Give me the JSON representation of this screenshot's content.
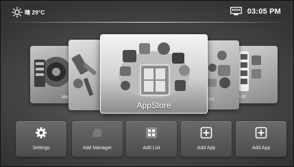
{
  "status_bar": {
    "weather_icon": "sun-icon",
    "weather_text": "晴 29°C",
    "network_icon": "ethernet-icon",
    "time": "03:05  PM"
  },
  "carousel": {
    "cards": [
      {
        "label": "Me",
        "icon": "media-icon"
      },
      {
        "label": "",
        "icon": "tools-icon"
      },
      {
        "label": "AppStore",
        "icon": "appstore-icon"
      },
      {
        "label": "ment",
        "icon": "management-icon"
      },
      {
        "label": "List",
        "icon": "list-icon"
      }
    ]
  },
  "dock": {
    "items": [
      {
        "label": "Settings",
        "icon": "gear-icon"
      },
      {
        "label": "Add Manager",
        "icon": "manager-icon"
      },
      {
        "label": "Add List",
        "icon": "grid-icon"
      },
      {
        "label": "Add App",
        "icon": "add-app-icon"
      },
      {
        "label": "Add App",
        "icon": "add-app-icon"
      }
    ]
  }
}
